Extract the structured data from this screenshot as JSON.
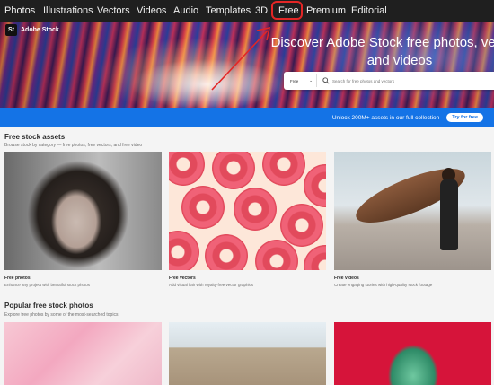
{
  "nav": {
    "items": [
      "Photos",
      "Illustrations",
      "Vectors",
      "Videos",
      "Audio",
      "Templates",
      "3D",
      "Free",
      "Premium",
      "Editorial"
    ],
    "active": "Free"
  },
  "brand": {
    "logo": "St",
    "name": "Adobe Stock"
  },
  "hero": {
    "title": "Discover Adobe Stock free photos, vectors, and videos",
    "search_scope": "Free",
    "search_placeholder": "Search for free photos and vectors"
  },
  "banner": {
    "text": "Unlock 200M+ assets in our full collection",
    "button": "Try for free"
  },
  "free_assets": {
    "title": "Free stock assets",
    "subtitle": "Browse stock by category — free photos, free vectors, and free video",
    "cards": [
      {
        "title": "Free photos",
        "desc": "Enhance any project with beautiful stock photos"
      },
      {
        "title": "Free vectors",
        "desc": "Add visual flair with royalty-free vector graphics"
      },
      {
        "title": "Free videos",
        "desc": "Create engaging stories with high-quality stock footage"
      }
    ]
  },
  "popular": {
    "title": "Popular free stock photos",
    "subtitle": "Explore free photos by some of the most-searched topics"
  },
  "colors": {
    "nav_bg": "#1f1f1f",
    "banner_blue": "#1473e6",
    "annotation_red": "#e32626",
    "donut_pink": "#e24a5c"
  }
}
